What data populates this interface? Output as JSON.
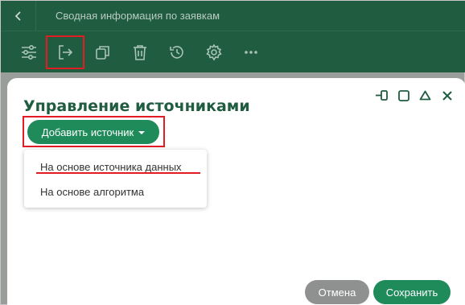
{
  "header": {
    "title": "Сводная информация по заявкам"
  },
  "toolbar": {
    "icons": [
      "sliders-icon",
      "export-icon",
      "copy-icon",
      "trash-icon",
      "history-icon",
      "gear-icon",
      "more-icon"
    ]
  },
  "dialog": {
    "title": "Управление источниками",
    "add_button": "Добавить источник",
    "menu": [
      "На основе источника данных",
      "На основе алгоритма"
    ],
    "cancel": "Отмена",
    "save": "Сохранить"
  },
  "colors": {
    "header_bg": "#1f5c40",
    "accent": "#1f8a5a",
    "highlight": "#e31b23",
    "cancel": "#8e918f"
  }
}
